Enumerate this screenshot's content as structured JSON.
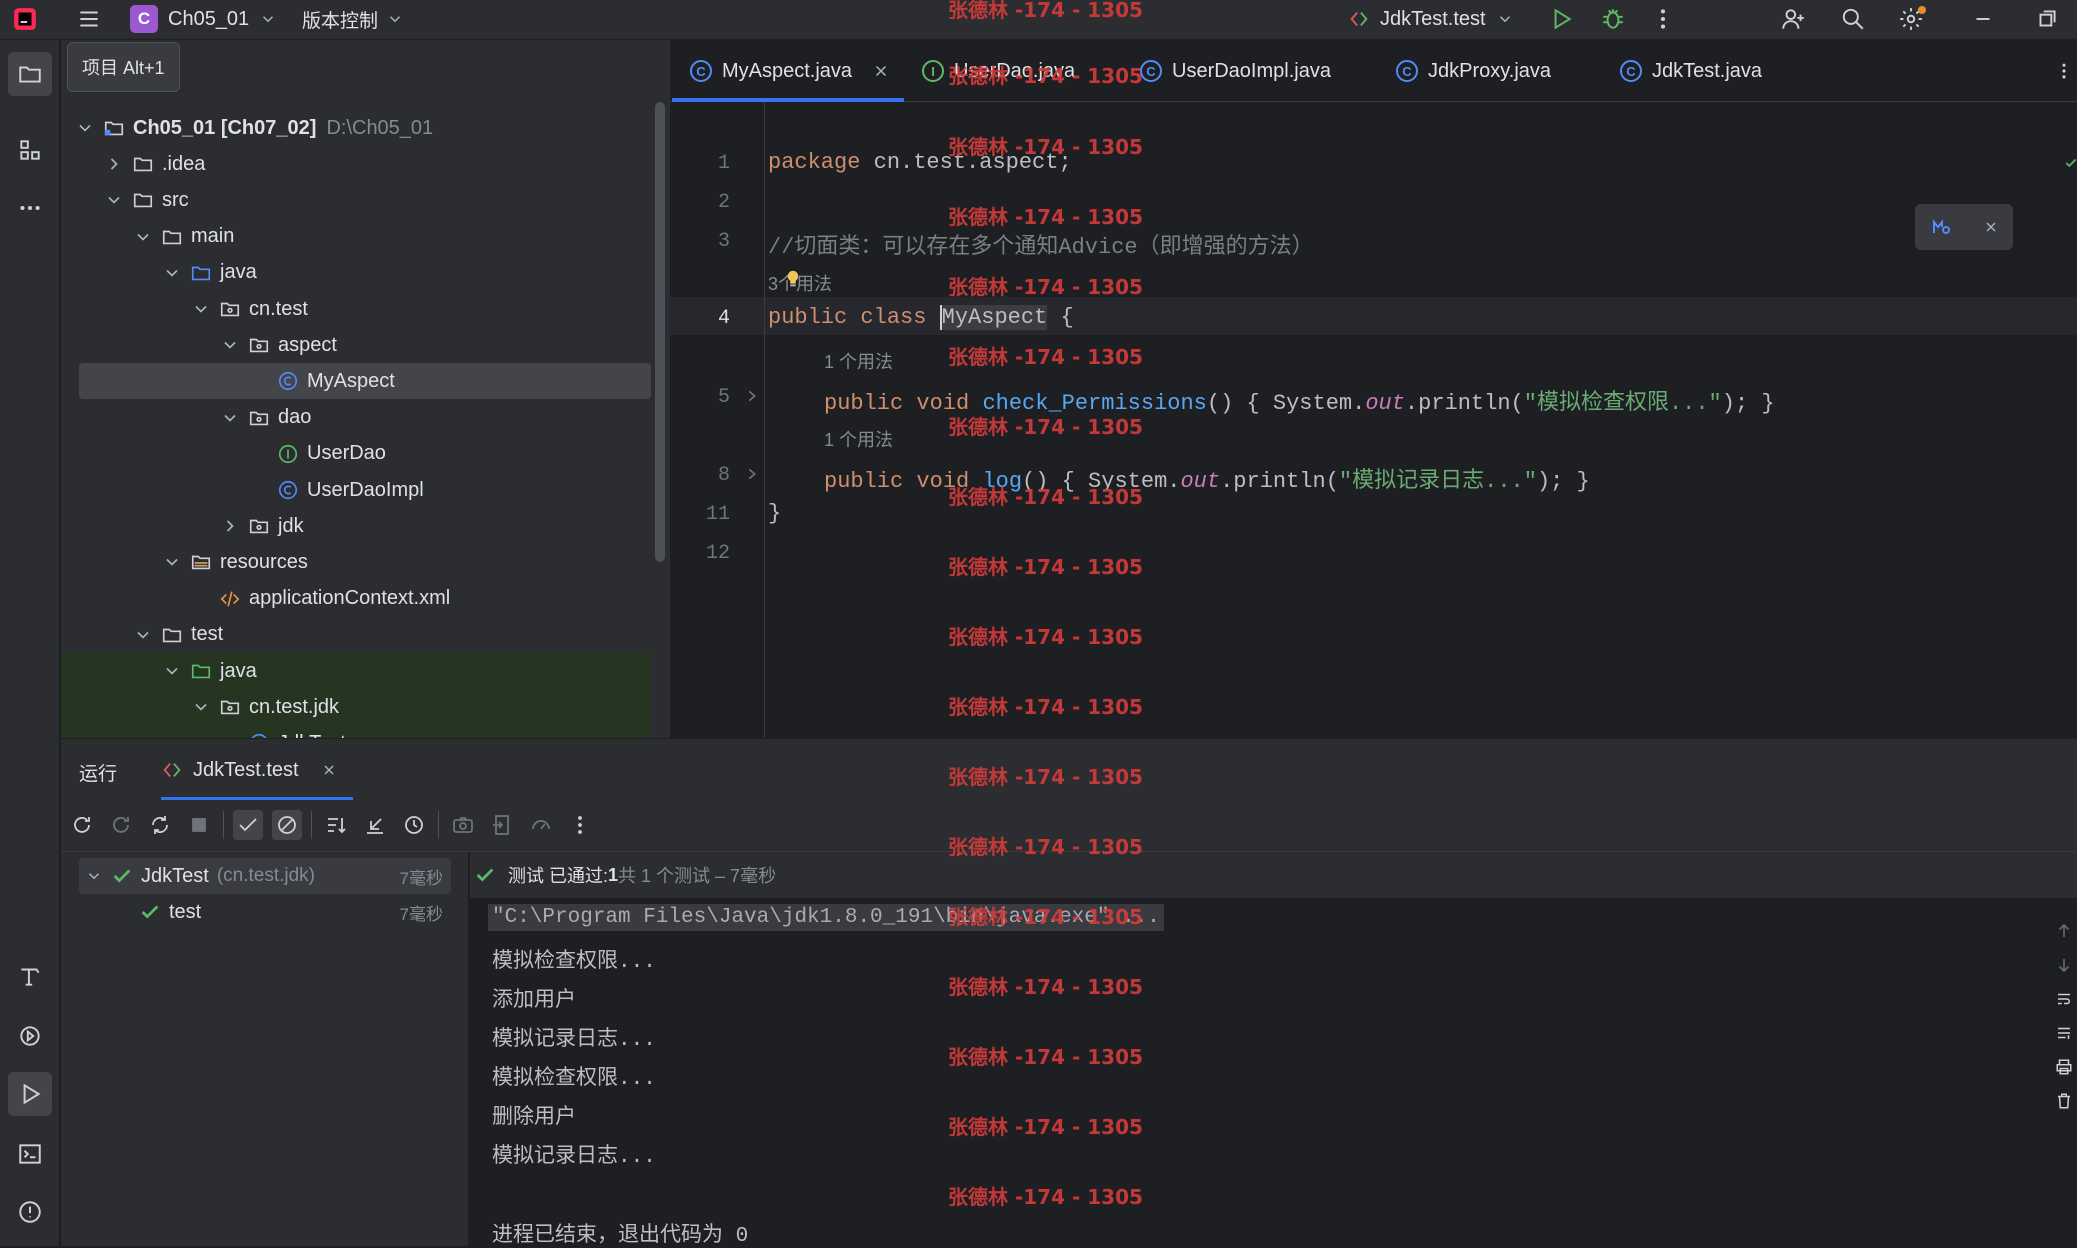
{
  "titlebar": {
    "project_name": "Ch05_01",
    "project_badge": "C",
    "vcs_menu": "版本控制",
    "run_config": "JdkTest.test"
  },
  "project_panel": {
    "tooltip": "项目  Alt+1",
    "items": [
      {
        "label": "Ch05_01 [Ch07_02]",
        "path": "D:\\Ch05_01"
      },
      {
        "label": ".idea"
      },
      {
        "label": "src"
      },
      {
        "label": "main"
      },
      {
        "label": "java"
      },
      {
        "label": "cn.test"
      },
      {
        "label": "aspect"
      },
      {
        "label": "MyAspect"
      },
      {
        "label": "dao"
      },
      {
        "label": "UserDao"
      },
      {
        "label": "UserDaoImpl"
      },
      {
        "label": "jdk"
      },
      {
        "label": "resources"
      },
      {
        "label": "applicationContext.xml"
      },
      {
        "label": "test"
      },
      {
        "label": "java"
      },
      {
        "label": "cn.test.jdk"
      },
      {
        "label": "JdkTest"
      }
    ]
  },
  "editor": {
    "tabs": [
      {
        "label": "MyAspect.java",
        "active": true
      },
      {
        "label": "UserDao.java"
      },
      {
        "label": "UserDaoImpl.java"
      },
      {
        "label": "JdkProxy.java"
      },
      {
        "label": "JdkTest.java"
      }
    ],
    "line_numbers": [
      "1",
      "2",
      "3",
      "4",
      "5",
      "8",
      "11",
      "12"
    ],
    "code": {
      "l1_kw": "package",
      "l1_rest": " cn.test.aspect;",
      "l3_comment": "//切面类：可以存在多个通知Advice（即增强的方法）",
      "usage_3": "3个用法",
      "l4_kw": "public class ",
      "l4_name": "MyAspect",
      "l4_rest": " {",
      "usage_1a": "1 个用法",
      "l5_kw": "public void ",
      "l5_fn": "check_Permissions",
      "l5_rest1": "() { System.",
      "l5_out": "out",
      "l5_rest2": ".println(",
      "l5_str": "\"模拟检查权限...\"",
      "l5_rest3": "); }",
      "usage_1b": "1 个用法",
      "l8_kw": "public void ",
      "l8_fn": "log",
      "l8_rest1": "() { System.",
      "l8_out": "out",
      "l8_rest2": ".println(",
      "l8_str": "\"模拟记录日志...\"",
      "l8_rest3": "); }",
      "l11": "}"
    }
  },
  "run_panel": {
    "title": "运行",
    "tab": "JdkTest.test",
    "status_prefix": "测试 已通过: ",
    "status_count": "1",
    "status_suffix": "共 1 个测试 – 7毫秒",
    "tests": [
      {
        "name": "JdkTest",
        "pkg": "(cn.test.jdk)",
        "time": "7毫秒"
      },
      {
        "name": "test",
        "time": "7毫秒"
      }
    ],
    "console": [
      "\"C:\\Program Files\\Java\\jdk1.8.0_191\\bin\\java.exe\" ...",
      "模拟检查权限...",
      "添加用户",
      "模拟记录日志...",
      "模拟检查权限...",
      "删除用户",
      "模拟记录日志...",
      "",
      "进程已结束，退出代码为 0"
    ]
  },
  "watermark": "张德林 -174 - 1305",
  "colors": {
    "accent": "#3574f0",
    "success": "#5fb865",
    "keyword": "#cf8e6d",
    "function": "#56a8f5",
    "string": "#6aab73"
  }
}
